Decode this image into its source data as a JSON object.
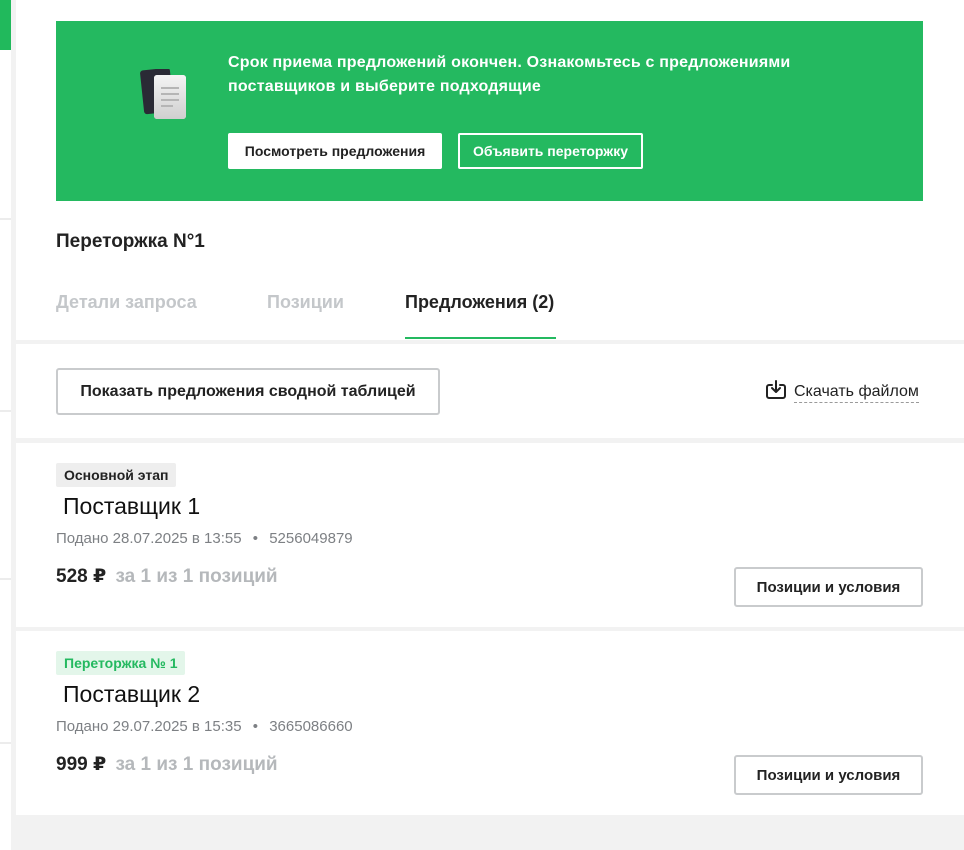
{
  "colors": {
    "accent": "#24b960",
    "muted": "#c4c7ca",
    "text": "#222222"
  },
  "banner": {
    "icon": "document-stack-icon",
    "message": "Срок приема предложений окончен. Ознакомьтесь с предложениями поставщиков и выберите подходящие",
    "view_offers_label": "Посмотреть предложения",
    "announce_rebid_label": "Объявить переторжку"
  },
  "section": {
    "title": "Переторжка N°1"
  },
  "tabs": [
    {
      "label": "Детали запроса",
      "active": false
    },
    {
      "label": "Позиции",
      "active": false
    },
    {
      "label": "Предложения (2)",
      "active": true
    }
  ],
  "toolbar": {
    "summary_table_label": "Показать предложения сводной таблицей",
    "download_icon": "download-icon",
    "download_label": "Скачать файлом"
  },
  "offers": [
    {
      "stage": "Основной этап",
      "supplier": "Поставщик 1",
      "submitted": "Подано 28.07.2025 в 13:55",
      "separator": "•",
      "inn": "5256049879",
      "price": "528 ₽",
      "positions": "за 1 из 1 позиций",
      "terms_label": "Позиции и условия"
    },
    {
      "stage": "Переторжка № 1",
      "supplier": "Поставщик 2",
      "submitted": "Подано 29.07.2025 в 15:35",
      "separator": "•",
      "inn": "3665086660",
      "price": "999 ₽",
      "positions": "за 1 из 1 позиций",
      "terms_label": "Позиции и условия"
    }
  ]
}
